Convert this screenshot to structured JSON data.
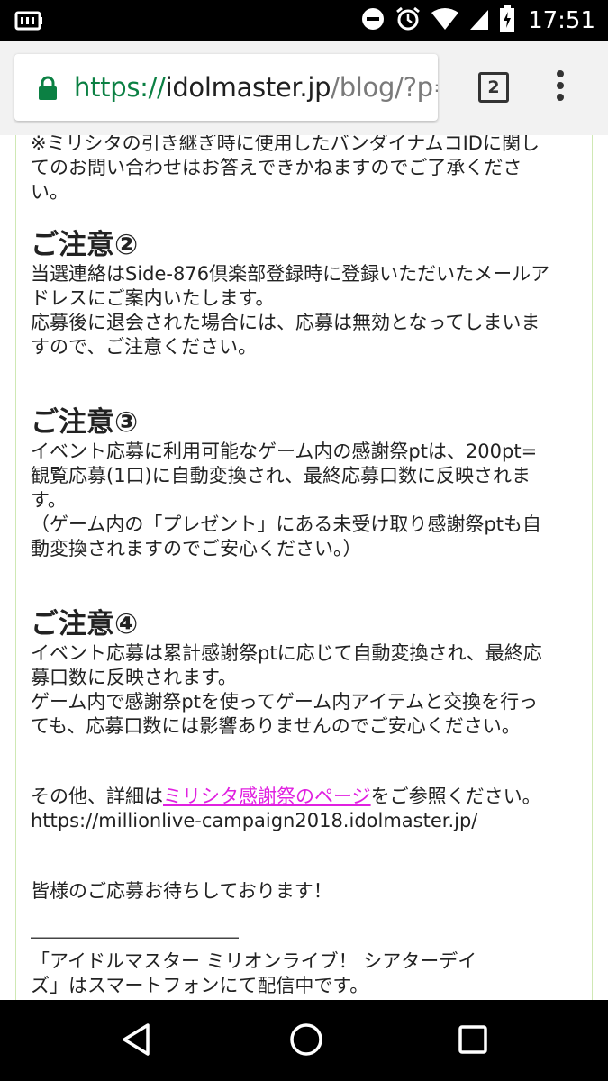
{
  "status_bar": {
    "time": "17:51",
    "icons": [
      "battery-saver-icon",
      "do-not-disturb-icon",
      "alarm-icon",
      "wifi-icon",
      "cell-signal-icon",
      "battery-charging-icon"
    ]
  },
  "browser": {
    "url_scheme": "https://",
    "url_host": "idolmaster.jp",
    "url_path": "/blog/?p=",
    "tab_count": "2"
  },
  "content": {
    "intro_lines": [
      "※ミリシタの引き継ぎ時に使用したバンダイナムコIDに関し",
      "てのお問い合わせはお答えできかねますのでご了承くださ",
      "い。"
    ],
    "note2_heading": "ご注意②",
    "note2_lines": [
      "当選連絡はSide-876倶楽部登録時に登録いただいたメールア",
      "ドレスにご案内いたします。",
      "応募後に退会された場合には、応募は無効となってしまいま",
      "すので、ご注意ください。"
    ],
    "note3_heading": "ご注意③",
    "note3_lines": [
      "イベント応募に利用可能なゲーム内の感謝祭ptは、200pt=",
      "観覧応募(1口)に自動変換され、最終応募口数に反映されま",
      "す。",
      "（ゲーム内の「プレゼント」にある未受け取り感謝祭ptも自",
      "動変換されますのでご安心ください。）"
    ],
    "note4_heading": "ご注意④",
    "note4_lines": [
      "イベント応募は累計感謝祭ptに応じて自動変換され、最終応",
      "募口数に反映されます。",
      "ゲーム内で感謝祭ptを使ってゲーム内アイテムと交換を行っ",
      "ても、応募口数には影響ありませんのでご安心ください。"
    ],
    "details_prefix": "その他、詳細は",
    "details_link": "ミリシタ感謝祭のページ",
    "details_suffix": "をご参照ください。",
    "details_url": "https://millionlive-campaign2018.idolmaster.jp/",
    "closing": "皆様のご応募お待ちしております！",
    "divider": "―――――――――――",
    "outro_lines": [
      "「アイドルマスター ミリオンライブ！ シアターデイ",
      "ズ」はスマートフォンにて配信中です。"
    ]
  },
  "nav_bar": {
    "buttons": [
      "back-icon",
      "home-icon",
      "recents-icon"
    ]
  }
}
